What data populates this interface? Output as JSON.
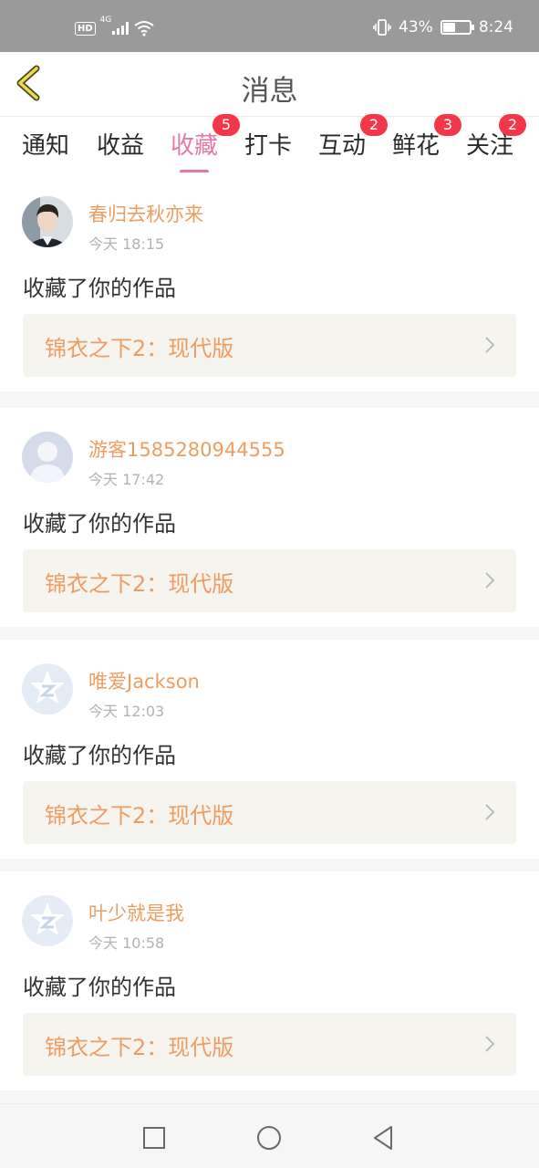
{
  "status_bar": {
    "hd": "HD",
    "network": "4G",
    "battery_percent": "43%",
    "battery_level": 0.43,
    "time": "8:24"
  },
  "header": {
    "title": "消息",
    "back_icon": "chevron-left-icon"
  },
  "tabs": [
    {
      "label": "通知",
      "active": false,
      "badge": ""
    },
    {
      "label": "收益",
      "active": false,
      "badge": ""
    },
    {
      "label": "收藏",
      "active": true,
      "badge": "5"
    },
    {
      "label": "打卡",
      "active": false,
      "badge": ""
    },
    {
      "label": "互动",
      "active": false,
      "badge": "2"
    },
    {
      "label": "鲜花",
      "active": false,
      "badge": "3"
    },
    {
      "label": "关注",
      "active": false,
      "badge": "2"
    }
  ],
  "notifications": [
    {
      "username": "春归去秋亦来",
      "time": "今天 18:15",
      "action": "收藏了你的作品",
      "work": "锦衣之下2：现代版",
      "avatar": "photo"
    },
    {
      "username": "游客1585280944555",
      "time": "今天 17:42",
      "action": "收藏了你的作品",
      "work": "锦衣之下2：现代版",
      "avatar": "default-person"
    },
    {
      "username": "唯爱Jackson",
      "time": "今天 12:03",
      "action": "收藏了你的作品",
      "work": "锦衣之下2：现代版",
      "avatar": "qq-default"
    },
    {
      "username": "叶少就是我",
      "time": "今天 10:58",
      "action": "收藏了你的作品",
      "work": "锦衣之下2：现代版",
      "avatar": "qq-default"
    }
  ],
  "colors": {
    "accent_pink": "#e37aa6",
    "username_orange": "#ee9d62",
    "badge_red": "#f2374b",
    "work_box_bg": "#f5f4ee"
  },
  "nav_bar": {
    "recents_icon": "square-icon",
    "home_icon": "circle-icon",
    "back_icon": "triangle-back-icon"
  }
}
